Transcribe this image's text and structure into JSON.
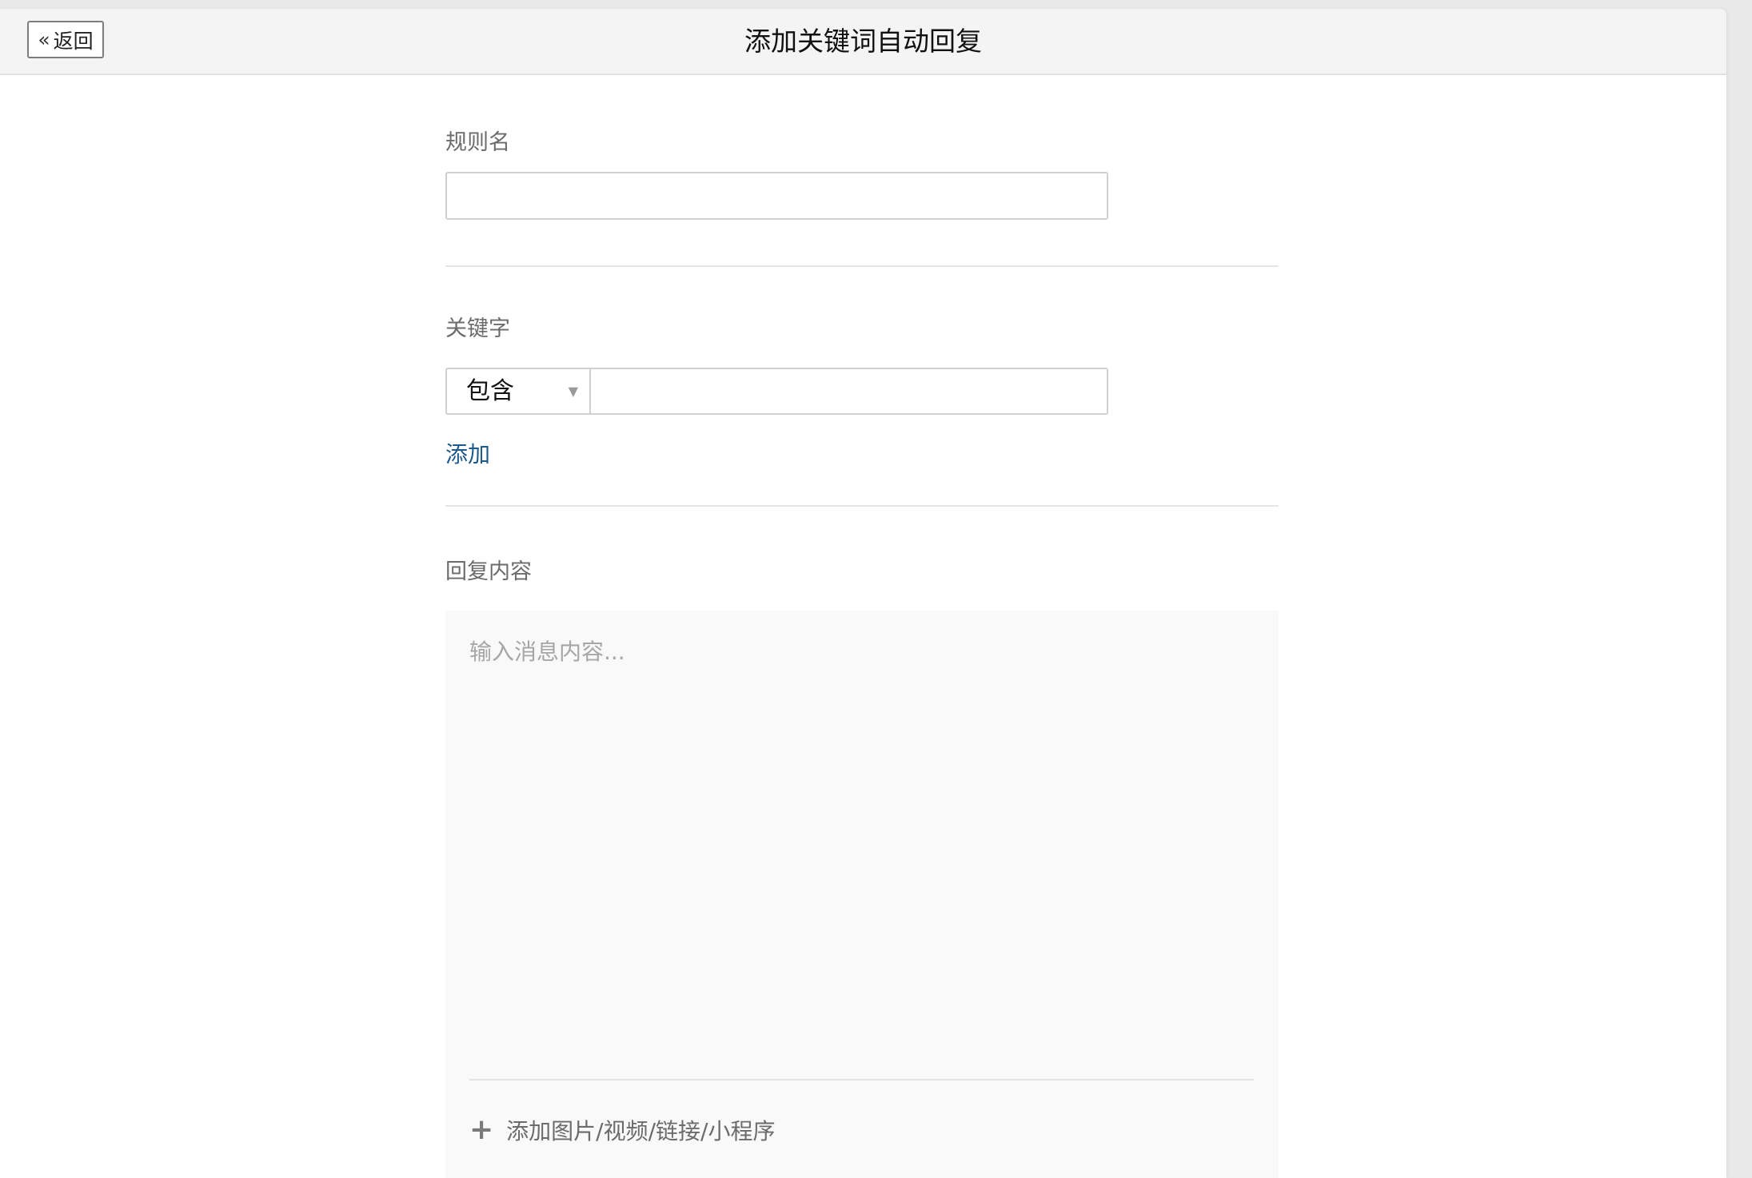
{
  "header": {
    "back_label": "返回",
    "title": "添加关键词自动回复"
  },
  "rule_name": {
    "label": "规则名",
    "value": "",
    "placeholder": ""
  },
  "keyword": {
    "label": "关键字",
    "match_select": "包含",
    "value": "",
    "add_label": "添加"
  },
  "reply": {
    "label": "回复内容",
    "placeholder": "输入消息内容...",
    "attach_label": "添加图片/视频/链接/小程序"
  },
  "icons": {
    "back": "double-chevron-left-icon",
    "dropdown": "triangle-down-icon",
    "attach": "plus-icon"
  },
  "colors": {
    "link": "#1d5a8c",
    "label": "#6b6b6b",
    "input_border": "#cfcfcf",
    "reply_bg": "#f9f9f9",
    "topbar_bg": "#f4f4f4"
  }
}
